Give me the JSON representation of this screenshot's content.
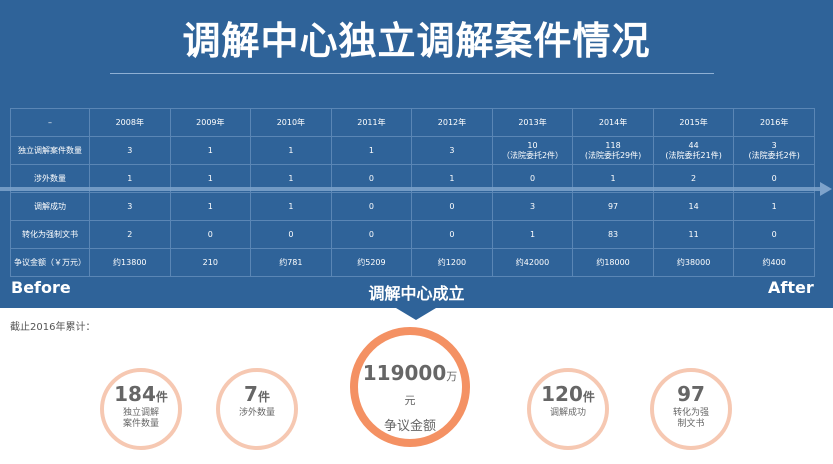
{
  "header": {
    "title": "调解中心独立调解案件情况"
  },
  "table": {
    "corner": "–",
    "years": [
      "2008年",
      "2009年",
      "2010年",
      "2011年",
      "2012年",
      "2013年",
      "2014年",
      "2015年",
      "2016年"
    ],
    "rows": [
      {
        "label": "独立调解案件数量",
        "cells": [
          [
            "3",
            ""
          ],
          [
            "1",
            ""
          ],
          [
            "1",
            ""
          ],
          [
            "1",
            ""
          ],
          [
            "3",
            ""
          ],
          [
            "10",
            "（法院委托2件）"
          ],
          [
            "118",
            "(法院委托29件)"
          ],
          [
            "44",
            "(法院委托21件)"
          ],
          [
            "3",
            "(法院委托2件)"
          ]
        ]
      },
      {
        "label": "涉外数量",
        "cells": [
          [
            "1"
          ],
          [
            "1"
          ],
          [
            "1"
          ],
          [
            "0"
          ],
          [
            "1"
          ],
          [
            "0"
          ],
          [
            "1"
          ],
          [
            "2"
          ],
          [
            "0"
          ]
        ]
      },
      {
        "label": "调解成功",
        "cells": [
          [
            "3"
          ],
          [
            "1"
          ],
          [
            "1"
          ],
          [
            "0"
          ],
          [
            "0"
          ],
          [
            "3"
          ],
          [
            "97"
          ],
          [
            "14"
          ],
          [
            "1"
          ]
        ]
      },
      {
        "label": "转化为强制文书",
        "cells": [
          [
            "2"
          ],
          [
            "0"
          ],
          [
            "0"
          ],
          [
            "0"
          ],
          [
            "0"
          ],
          [
            "1"
          ],
          [
            "83"
          ],
          [
            "11"
          ],
          [
            "0"
          ]
        ]
      },
      {
        "label": "争议金额（￥万元）",
        "cells": [
          [
            "约13800"
          ],
          [
            "210"
          ],
          [
            "约781"
          ],
          [
            "约5209"
          ],
          [
            "约1200"
          ],
          [
            "约42000"
          ],
          [
            "约18000"
          ],
          [
            "约38000"
          ],
          [
            "约400"
          ]
        ]
      }
    ]
  },
  "timeline": {
    "before": "Before",
    "after": "After",
    "founded": "调解中心成立"
  },
  "summary": {
    "heading": "截止2016年累计：",
    "stats": [
      {
        "value": "184",
        "unit": "件",
        "label_lines": [
          "独立调解",
          "案件数量"
        ]
      },
      {
        "value": "7",
        "unit": "件",
        "label_lines": [
          "涉外数量"
        ]
      },
      {
        "value": "119000",
        "unit": "万元",
        "label_lines": [
          "争议金额"
        ]
      },
      {
        "value": "120",
        "unit": "件",
        "label_lines": [
          "调解成功"
        ]
      },
      {
        "value": "97",
        "unit": "",
        "label_lines": [
          "转化为强",
          "制文书"
        ]
      }
    ]
  },
  "colors": {
    "banner": "#2f6399",
    "big_ring": "#f49163",
    "small_ring": "#f6c8b2"
  }
}
